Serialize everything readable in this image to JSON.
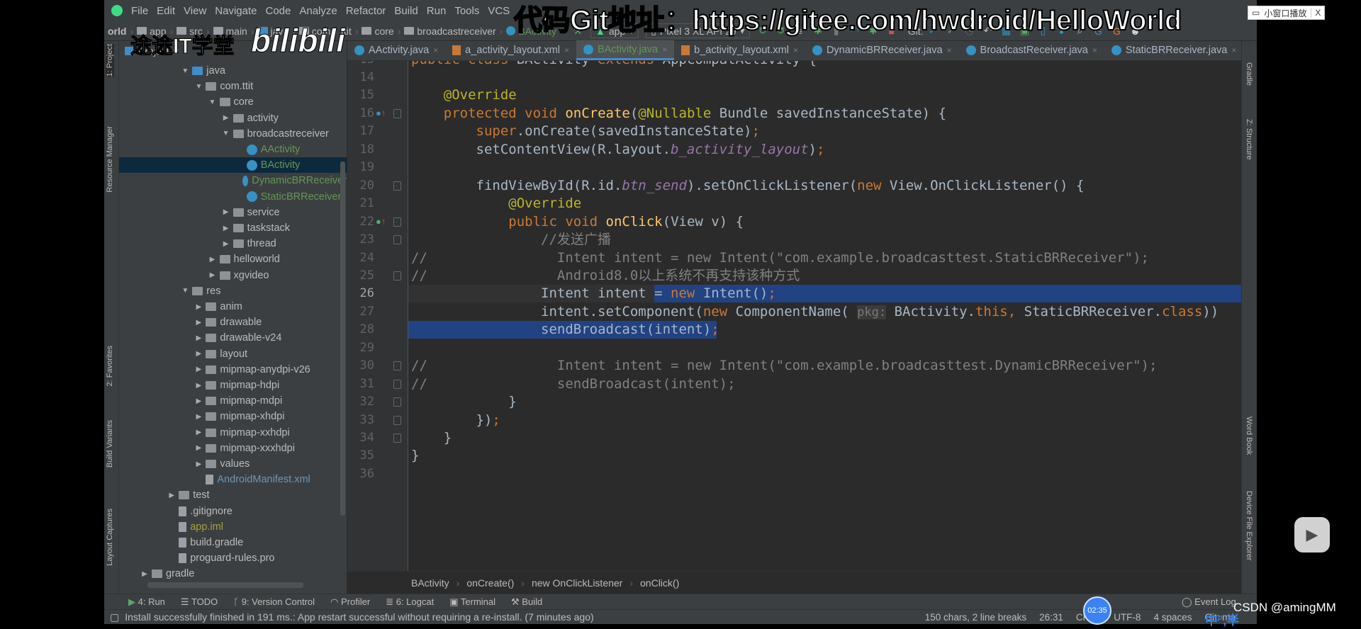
{
  "menu": [
    "File",
    "Edit",
    "View",
    "Navigate",
    "Code",
    "Analyze",
    "Refactor",
    "Build",
    "Run",
    "Tools",
    "VCS"
  ],
  "breadcrumb": [
    "orld",
    "app",
    "src",
    "main",
    "java",
    "com",
    "ttit",
    "core",
    "broadcastreceiver",
    "BActivity"
  ],
  "toolbar": {
    "run_config": "app",
    "device": "Pixel 3 XL API 29",
    "git_label": "Git:"
  },
  "project_panel": {
    "title": "Project"
  },
  "tree": [
    {
      "label": "java",
      "depth": 3,
      "arrow": "open",
      "icon": "folder-blue"
    },
    {
      "label": "com.ttit",
      "depth": 4,
      "arrow": "open",
      "icon": "package"
    },
    {
      "label": "core",
      "depth": 5,
      "arrow": "open",
      "icon": "package"
    },
    {
      "label": "activity",
      "depth": 6,
      "arrow": "closed",
      "icon": "package"
    },
    {
      "label": "broadcastreceiver",
      "depth": 6,
      "arrow": "open",
      "icon": "package"
    },
    {
      "label": "AActivity",
      "depth": 7,
      "icon": "class",
      "color": "#629755"
    },
    {
      "label": "BActivity",
      "depth": 7,
      "icon": "class",
      "color": "#629755",
      "selected": true
    },
    {
      "label": "DynamicBRReceiver",
      "depth": 7,
      "icon": "class",
      "color": "#629755"
    },
    {
      "label": "StaticBRReceiver",
      "depth": 7,
      "icon": "class",
      "color": "#629755"
    },
    {
      "label": "service",
      "depth": 6,
      "arrow": "closed",
      "icon": "package"
    },
    {
      "label": "taskstack",
      "depth": 6,
      "arrow": "closed",
      "icon": "package"
    },
    {
      "label": "thread",
      "depth": 6,
      "arrow": "closed",
      "icon": "package"
    },
    {
      "label": "helloworld",
      "depth": 5,
      "arrow": "closed",
      "icon": "package"
    },
    {
      "label": "xgvideo",
      "depth": 5,
      "arrow": "closed",
      "icon": "package"
    },
    {
      "label": "res",
      "depth": 3,
      "arrow": "open",
      "icon": "folder"
    },
    {
      "label": "anim",
      "depth": 4,
      "arrow": "closed",
      "icon": "package"
    },
    {
      "label": "drawable",
      "depth": 4,
      "arrow": "closed",
      "icon": "package"
    },
    {
      "label": "drawable-v24",
      "depth": 4,
      "arrow": "closed",
      "icon": "package"
    },
    {
      "label": "layout",
      "depth": 4,
      "arrow": "closed",
      "icon": "package"
    },
    {
      "label": "mipmap-anydpi-v26",
      "depth": 4,
      "arrow": "closed",
      "icon": "package"
    },
    {
      "label": "mipmap-hdpi",
      "depth": 4,
      "arrow": "closed",
      "icon": "package"
    },
    {
      "label": "mipmap-mdpi",
      "depth": 4,
      "arrow": "closed",
      "icon": "package"
    },
    {
      "label": "mipmap-xhdpi",
      "depth": 4,
      "arrow": "closed",
      "icon": "package"
    },
    {
      "label": "mipmap-xxhdpi",
      "depth": 4,
      "arrow": "closed",
      "icon": "package"
    },
    {
      "label": "mipmap-xxxhdpi",
      "depth": 4,
      "arrow": "closed",
      "icon": "package"
    },
    {
      "label": "values",
      "depth": 4,
      "arrow": "closed",
      "icon": "package"
    },
    {
      "label": "AndroidManifest.xml",
      "depth": 4,
      "icon": "file",
      "color": "#6897bb"
    },
    {
      "label": "test",
      "depth": 2,
      "arrow": "closed",
      "icon": "folder"
    },
    {
      "label": ".gitignore",
      "depth": 2,
      "icon": "file"
    },
    {
      "label": "app.iml",
      "depth": 2,
      "icon": "file",
      "color": "#a4a23c"
    },
    {
      "label": "build.gradle",
      "depth": 2,
      "icon": "file"
    },
    {
      "label": "proguard-rules.pro",
      "depth": 2,
      "icon": "file"
    },
    {
      "label": "gradle",
      "depth": 0,
      "arrow": "closed",
      "icon": "folder"
    },
    {
      "label": "学习课件",
      "depth": 0,
      "arrow": "closed",
      "icon": "folder"
    }
  ],
  "tabs": [
    {
      "label": "AActivity.java",
      "type": "java"
    },
    {
      "label": "a_activity_layout.xml",
      "type": "xml"
    },
    {
      "label": "BActivity.java",
      "type": "java",
      "active": true
    },
    {
      "label": "b_activity_layout.xml",
      "type": "xml"
    },
    {
      "label": "DynamicBRReceiver.java",
      "type": "java"
    },
    {
      "label": "BroadcastReceiver.java",
      "type": "java"
    },
    {
      "label": "StaticBRReceiver.java",
      "type": "java"
    }
  ],
  "editor": {
    "current_line": 26,
    "lines": [
      {
        "n": 13,
        "t": [
          [
            "public class ",
            "kw"
          ],
          [
            "BActivity ",
            "pl"
          ],
          [
            "extends ",
            "kw"
          ],
          [
            "AppCompatActivity {",
            "pl"
          ]
        ]
      },
      {
        "n": 14,
        "t": []
      },
      {
        "n": 15,
        "t": [
          [
            "    @Override",
            "ann"
          ]
        ]
      },
      {
        "n": 16,
        "t": [
          [
            "    protected void ",
            "kw"
          ],
          [
            "onCreate",
            "fn"
          ],
          [
            "(",
            "pl"
          ],
          [
            "@Nullable ",
            "ann"
          ],
          [
            "Bundle savedInstanceState) {",
            "pl"
          ]
        ]
      },
      {
        "n": 17,
        "t": [
          [
            "        super",
            "kw"
          ],
          [
            ".onCreate(savedInstanceState)",
            "pl"
          ],
          [
            ";",
            "kw"
          ]
        ]
      },
      {
        "n": 18,
        "t": [
          [
            "        setContentView(R.layout.",
            "pl"
          ],
          [
            "b_activity_layout",
            "it"
          ],
          [
            ")",
            "pl"
          ],
          [
            ";",
            "kw"
          ]
        ]
      },
      {
        "n": 19,
        "t": []
      },
      {
        "n": 20,
        "t": [
          [
            "        findViewById(R.id.",
            "pl"
          ],
          [
            "btn_send",
            "it"
          ],
          [
            ").setOnClickListener(",
            "pl"
          ],
          [
            "new ",
            "kw"
          ],
          [
            "View.OnClickListener() {",
            "pl"
          ]
        ]
      },
      {
        "n": 21,
        "t": [
          [
            "            @Override",
            "ann"
          ]
        ]
      },
      {
        "n": 22,
        "t": [
          [
            "            public void ",
            "kw"
          ],
          [
            "onClick",
            "fn"
          ],
          [
            "(View v) {",
            "pl"
          ]
        ]
      },
      {
        "n": 23,
        "t": [
          [
            "                //发送广播",
            "cm"
          ]
        ]
      },
      {
        "n": 24,
        "t": [
          [
            "//                Intent intent = new Intent(\"com.example.broadcasttest.StaticBRReceiver\");",
            "cm"
          ]
        ]
      },
      {
        "n": 25,
        "t": [
          [
            "//                Android8.0以上系统不再支持该种方式",
            "cm"
          ]
        ]
      },
      {
        "n": 26,
        "t": [
          [
            "                Intent intent = ",
            "pl"
          ],
          [
            "new ",
            "kw"
          ],
          [
            "Intent()",
            "pl"
          ],
          [
            ";",
            "kw"
          ]
        ]
      },
      {
        "n": 27,
        "t": [
          [
            "                intent.setComponent(",
            "pl"
          ],
          [
            "new ",
            "kw"
          ],
          [
            "ComponentName( ",
            "pl"
          ],
          [
            "pkg:",
            "hint"
          ],
          [
            " BActivity.",
            "pl"
          ],
          [
            "this",
            "kw"
          ],
          [
            ", ",
            "kw"
          ],
          [
            "StaticBRReceiver.",
            "pl"
          ],
          [
            "class",
            "kw"
          ],
          [
            "))",
            "pl"
          ]
        ]
      },
      {
        "n": 28,
        "t": [
          [
            "                sendBroadcast(intent)",
            "pl"
          ],
          [
            ";",
            "kw"
          ]
        ]
      },
      {
        "n": 29,
        "t": []
      },
      {
        "n": 30,
        "t": [
          [
            "//                Intent intent = new Intent(\"com.example.broadcasttest.DynamicBRReceiver\");",
            "cm"
          ]
        ]
      },
      {
        "n": 31,
        "t": [
          [
            "//                sendBroadcast(intent);",
            "cm"
          ]
        ]
      },
      {
        "n": 32,
        "t": [
          [
            "            }",
            "pl"
          ]
        ]
      },
      {
        "n": 33,
        "t": [
          [
            "        })",
            "pl"
          ],
          [
            ";",
            "kw"
          ]
        ]
      },
      {
        "n": 34,
        "t": [
          [
            "    }",
            "pl"
          ]
        ]
      },
      {
        "n": 35,
        "t": [
          [
            "}",
            "pl"
          ]
        ]
      },
      {
        "n": 36,
        "t": []
      }
    ]
  },
  "editor_breadcrumb": [
    "BActivity",
    "onCreate()",
    "new OnClickListener",
    "onClick()"
  ],
  "left_strip": [
    "1: Project",
    "Resource Manager",
    "2: Favorites",
    "Build Variants",
    "Layout Captures"
  ],
  "right_strip": [
    "Gradle",
    "Z: Structure",
    "Word Book",
    "Device File Explorer"
  ],
  "tool_windows": [
    "4: Run",
    "TODO",
    "9: Version Control",
    "Profiler",
    "6: Logcat",
    "Terminal",
    "Build"
  ],
  "event_log": "Event Log",
  "status": {
    "message": "Install successfully finished in 191 ms.: App restart successful without requiring a re-install. (7 minutes ago)",
    "selection": "150 chars, 2 line breaks",
    "position": "26:31",
    "line_sep": "CRLF",
    "encoding": "UTF-8",
    "indent": "4 spaces",
    "git": "Git: ma"
  },
  "overlay": {
    "watermark": "代码Git地址：https://gitee.com/hwdroid/HelloWorld",
    "brand": "途途IT学堂",
    "bilibili": "bilibili",
    "pip_button": "小窗口播放",
    "pip_close": "X",
    "timer": "02:35",
    "csdn": "CSDN @amingMM"
  }
}
